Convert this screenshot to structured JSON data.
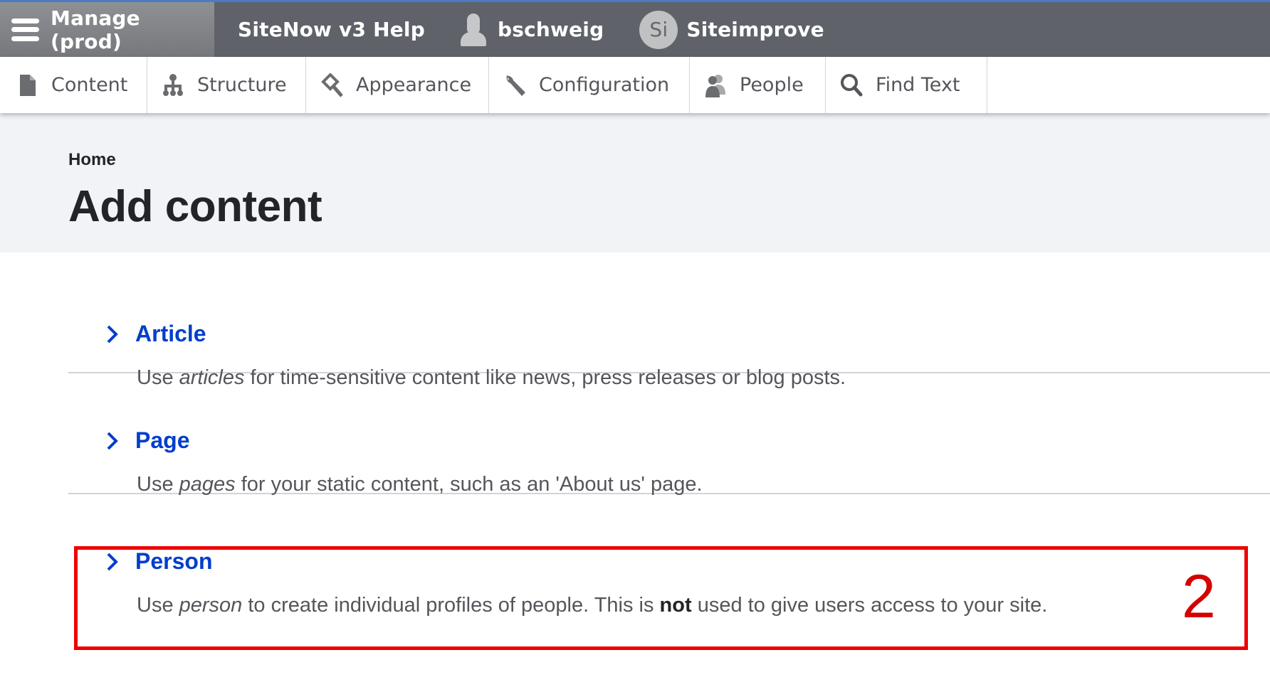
{
  "topbar": {
    "manage_label": "Manage (prod)",
    "help_label": "SiteNow v3 Help",
    "user_label": "bschweig",
    "siteimprove_badge": "Si",
    "siteimprove_label": "Siteimprove"
  },
  "toolbar": {
    "items": [
      {
        "label": "Content",
        "icon": "file-icon"
      },
      {
        "label": "Structure",
        "icon": "sitemap-icon"
      },
      {
        "label": "Appearance",
        "icon": "paintbrush-icon"
      },
      {
        "label": "Configuration",
        "icon": "wrench-icon"
      },
      {
        "label": "People",
        "icon": "people-icon"
      },
      {
        "label": "Find Text",
        "icon": "search-icon"
      }
    ]
  },
  "header": {
    "breadcrumb": "Home",
    "title": "Add content"
  },
  "content_types": [
    {
      "label": "Article",
      "desc_pre": "Use ",
      "desc_em": "articles",
      "desc_post": " for time-sensitive content like news, press releases or blog posts."
    },
    {
      "label": "Page",
      "desc_pre": "Use ",
      "desc_em": "pages",
      "desc_post": " for your static content, such as an 'About us' page."
    },
    {
      "label": "Person",
      "desc_pre": "Use ",
      "desc_em": "person",
      "desc_mid": " to create individual profiles of people. This is ",
      "desc_strong": "not",
      "desc_post": " used to give users access to your site."
    }
  ],
  "annotation": {
    "number": "2",
    "color": "#ee0000"
  },
  "colors": {
    "link": "#003ecc",
    "topbar_bg": "#5f6268",
    "header_bg": "#f2f3f7"
  }
}
